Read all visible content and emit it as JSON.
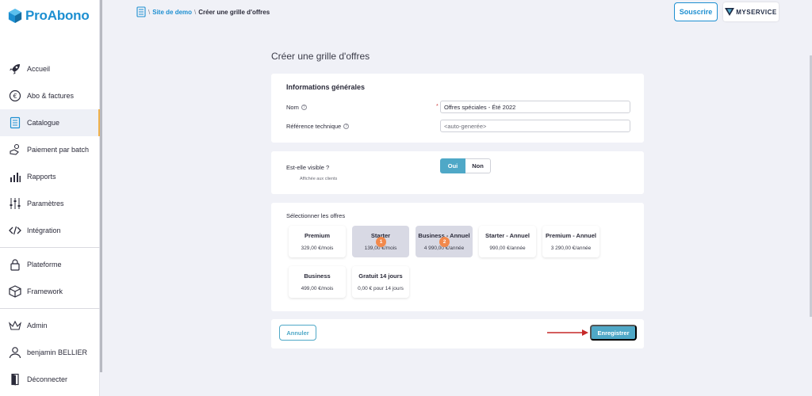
{
  "app": {
    "name": "ProAbono"
  },
  "sidebar": {
    "items": [
      {
        "label": "Accueil",
        "icon": "rocket-icon"
      },
      {
        "label": "Abo & factures",
        "icon": "euro-icon"
      },
      {
        "label": "Catalogue",
        "icon": "catalog-icon",
        "active": true
      },
      {
        "label": "Paiement par batch",
        "icon": "batch-payment-icon"
      },
      {
        "label": "Rapports",
        "icon": "reports-icon"
      },
      {
        "label": "Paramètres",
        "icon": "sliders-icon"
      },
      {
        "label": "Intégration",
        "icon": "code-icon"
      },
      {
        "label": "Plateforme",
        "icon": "lock-icon"
      },
      {
        "label": "Framework",
        "icon": "cube-icon"
      },
      {
        "label": "Admin",
        "icon": "crown-icon"
      },
      {
        "label": "benjamin BELLIER",
        "icon": "user-icon"
      },
      {
        "label": "Déconnecter",
        "icon": "door-icon"
      }
    ]
  },
  "breadcrumb": {
    "link": "Site de demo",
    "current": "Créer une grille d'offres"
  },
  "header": {
    "subscribe_label": "Souscrire",
    "brand_label": "MYSERVICE"
  },
  "page": {
    "title": "Créer une grille d'offres"
  },
  "general": {
    "title": "Informations générales",
    "name_label": "Nom",
    "name_value": "Offres spéciales - Été 2022",
    "ref_label": "Référence technique",
    "ref_placeholder": "<auto-generée>"
  },
  "visibility": {
    "label": "Est-elle visible ?",
    "sublabel": "Affichée aux clients",
    "yes": "Oui",
    "no": "Non"
  },
  "offers": {
    "title": "Sélectionner les offres",
    "items": [
      {
        "name": "Premium",
        "price": "329,00 €/mois"
      },
      {
        "name": "Starter",
        "price": "139,00 €/mois",
        "badge": "1"
      },
      {
        "name": "Business - Annuel",
        "price": "4 990,00 €/année",
        "badge": "2"
      },
      {
        "name": "Starter - Annuel",
        "price": "990,00 €/année"
      },
      {
        "name": "Premium - Annuel",
        "price": "3 290,00 €/année"
      },
      {
        "name": "Business",
        "price": "499,00 €/mois"
      },
      {
        "name": "Gratuit 14 jours",
        "price": "0,00 € pour 14 jours"
      }
    ]
  },
  "actions": {
    "cancel": "Annuler",
    "save": "Enregistrer"
  },
  "colors": {
    "brand": "#1d8fd1",
    "accent": "#4fa8c7",
    "badge": "#f2894c",
    "arrow": "#c62828"
  }
}
